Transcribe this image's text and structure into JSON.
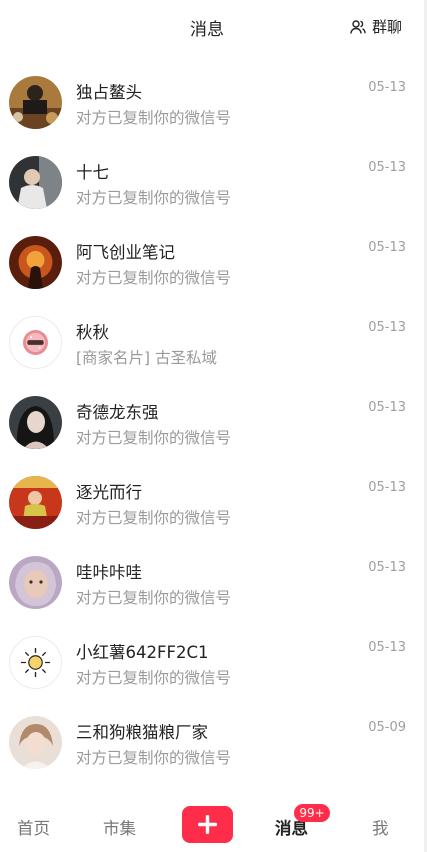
{
  "header": {
    "title": "消息",
    "group_chat_label": "群聊"
  },
  "conversations": [
    {
      "name": "独占鳌头",
      "preview": "对方已复制你的微信号",
      "time": "05-13",
      "avatar": "photo"
    },
    {
      "name": "十七",
      "preview": "对方已复制你的微信号",
      "time": "05-13",
      "avatar": "photo"
    },
    {
      "name": "阿飞创业笔记",
      "preview": "对方已复制你的微信号",
      "time": "05-13",
      "avatar": "photo"
    },
    {
      "name": "秋秋",
      "preview": "[商家名片] 古圣私域",
      "time": "05-13",
      "avatar": "donut-icon"
    },
    {
      "name": "奇德龙东强",
      "preview": "对方已复制你的微信号",
      "time": "05-13",
      "avatar": "photo"
    },
    {
      "name": "逐光而行",
      "preview": "对方已复制你的微信号",
      "time": "05-13",
      "avatar": "photo"
    },
    {
      "name": "哇咔咔哇",
      "preview": "对方已复制你的微信号",
      "time": "05-13",
      "avatar": "photo"
    },
    {
      "name": "小红薯642FF2C1",
      "preview": "对方已复制你的微信号",
      "time": "05-13",
      "avatar": "sun-icon"
    },
    {
      "name": "三和狗粮猫粮厂家",
      "preview": "对方已复制你的微信号",
      "time": "05-09",
      "avatar": "photo"
    }
  ],
  "tabbar": {
    "home": "首页",
    "market": "市集",
    "publish_icon": "plus-icon",
    "messages": "消息",
    "messages_badge": "99+",
    "me": "我"
  },
  "colors": {
    "accent": "#ff2d4a",
    "text": "#222222",
    "secondary": "#9a9a9a"
  }
}
